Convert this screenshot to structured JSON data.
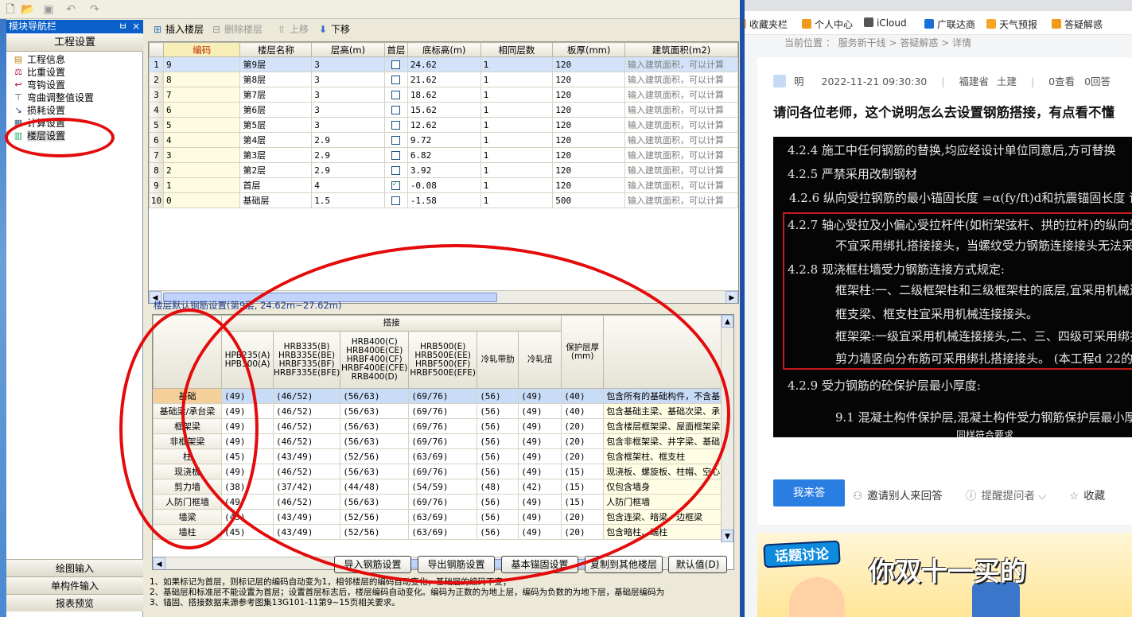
{
  "app": {
    "quick_toolbar": [
      "new-icon",
      "open-icon",
      "save-icon",
      "undo-icon",
      "redo-icon"
    ],
    "nav": {
      "title": "模块导航栏",
      "pin": "ㅂ",
      "close": "×",
      "header": "工程设置",
      "items": [
        {
          "label": "工程信息",
          "icon": "info-icon"
        },
        {
          "label": "比重设置",
          "icon": "weight-icon"
        },
        {
          "label": "弯钩设置",
          "icon": "hook-icon"
        },
        {
          "label": "弯曲调整值设置",
          "icon": "bend-icon"
        },
        {
          "label": "损耗设置",
          "icon": "loss-icon"
        },
        {
          "label": "计算设置",
          "icon": "calc-icon"
        },
        {
          "label": "楼层设置",
          "icon": "floor-icon",
          "selected": true
        }
      ],
      "bottom": [
        "绘图输入",
        "单构件输入",
        "报表预览"
      ]
    },
    "toolbar": {
      "insert": "插入楼层",
      "delete": "删除楼层",
      "up": "上移",
      "down": "下移"
    },
    "floors": {
      "columns": [
        "编码",
        "楼层名称",
        "层高(m)",
        "首层",
        "底标高(m)",
        "相同层数",
        "板厚(mm)",
        "建筑面积(m2)"
      ],
      "rows": [
        {
          "n": "1",
          "code": "9",
          "name": "第9层",
          "height": "3",
          "first": false,
          "base": "24.62",
          "same": "1",
          "slab": "120",
          "area": "输入建筑面积，可以计算"
        },
        {
          "n": "2",
          "code": "8",
          "name": "第8层",
          "height": "3",
          "first": false,
          "base": "21.62",
          "same": "1",
          "slab": "120",
          "area": "输入建筑面积，可以计算"
        },
        {
          "n": "3",
          "code": "7",
          "name": "第7层",
          "height": "3",
          "first": false,
          "base": "18.62",
          "same": "1",
          "slab": "120",
          "area": "输入建筑面积，可以计算"
        },
        {
          "n": "4",
          "code": "6",
          "name": "第6层",
          "height": "3",
          "first": false,
          "base": "15.62",
          "same": "1",
          "slab": "120",
          "area": "输入建筑面积，可以计算"
        },
        {
          "n": "5",
          "code": "5",
          "name": "第5层",
          "height": "3",
          "first": false,
          "base": "12.62",
          "same": "1",
          "slab": "120",
          "area": "输入建筑面积，可以计算"
        },
        {
          "n": "6",
          "code": "4",
          "name": "第4层",
          "height": "2.9",
          "first": false,
          "base": "9.72",
          "same": "1",
          "slab": "120",
          "area": "输入建筑面积，可以计算"
        },
        {
          "n": "7",
          "code": "3",
          "name": "第3层",
          "height": "2.9",
          "first": false,
          "base": "6.82",
          "same": "1",
          "slab": "120",
          "area": "输入建筑面积，可以计算"
        },
        {
          "n": "8",
          "code": "2",
          "name": "第2层",
          "height": "2.9",
          "first": false,
          "base": "3.92",
          "same": "1",
          "slab": "120",
          "area": "输入建筑面积，可以计算"
        },
        {
          "n": "9",
          "code": "1",
          "name": "首层",
          "height": "4",
          "first": true,
          "base": "-0.08",
          "same": "1",
          "slab": "120",
          "area": "输入建筑面积，可以计算"
        },
        {
          "n": "10",
          "code": "0",
          "name": "基础层",
          "height": "1.5",
          "first": false,
          "base": "-1.58",
          "same": "1",
          "slab": "500",
          "area": "输入建筑面积，可以计算"
        }
      ]
    },
    "rebar": {
      "section_title": "楼层默认钢筋设置(第9层, 24.62m~27.62m)",
      "group_header": "搭接",
      "columns": [
        "HPB235(A)\nHPB300(A)",
        "HRB335(B)\nHRB335E(BE)\nHRBF335(BF)\nHRBF335E(BFE)",
        "HRB400(C)\nHRB400E(CE)\nHRBF400(CF)\nHRBF400E(CFE)\nRRB400(D)",
        "HRB500(E)\nHRB500E(EE)\nHRBF500(EF)\nHRBF500E(EFE)",
        "冷轧带肋",
        "冷轧扭",
        "保护层厚\n(mm)",
        ""
      ],
      "rows": [
        {
          "label": "基础",
          "v": [
            "(49)",
            "(46/52)",
            "(56/63)",
            "(69/76)",
            "(56)",
            "(49)",
            "(40)"
          ],
          "desc": "包含所有的基础构件，不含基"
        },
        {
          "label": "基础梁/承台梁",
          "v": [
            "(49)",
            "(46/52)",
            "(56/63)",
            "(69/76)",
            "(56)",
            "(49)",
            "(40)"
          ],
          "desc": "包含基础主梁、基础次梁、承"
        },
        {
          "label": "框架梁",
          "v": [
            "(49)",
            "(46/52)",
            "(56/63)",
            "(69/76)",
            "(56)",
            "(49)",
            "(20)"
          ],
          "desc": "包含楼层框架梁、屋面框架梁"
        },
        {
          "label": "非框架梁",
          "v": [
            "(49)",
            "(46/52)",
            "(56/63)",
            "(69/76)",
            "(56)",
            "(49)",
            "(20)"
          ],
          "desc": "包含非框架梁、井字梁、基础"
        },
        {
          "label": "柱",
          "v": [
            "(45)",
            "(43/49)",
            "(52/56)",
            "(63/69)",
            "(56)",
            "(49)",
            "(20)"
          ],
          "desc": "包含框架柱、框支柱"
        },
        {
          "label": "现浇板",
          "v": [
            "(49)",
            "(46/52)",
            "(56/63)",
            "(69/76)",
            "(56)",
            "(49)",
            "(15)"
          ],
          "desc": "现浇板、螺旋板、柱帽、空心"
        },
        {
          "label": "剪力墙",
          "v": [
            "(38)",
            "(37/42)",
            "(44/48)",
            "(54/59)",
            "(48)",
            "(42)",
            "(15)"
          ],
          "desc": "仅包含墙身"
        },
        {
          "label": "人防门框墙",
          "v": [
            "(49)",
            "(46/52)",
            "(56/63)",
            "(69/76)",
            "(56)",
            "(49)",
            "(15)"
          ],
          "desc": "人防门框墙"
        },
        {
          "label": "墙梁",
          "v": [
            "(45)",
            "(43/49)",
            "(52/56)",
            "(63/69)",
            "(56)",
            "(49)",
            "(20)"
          ],
          "desc": "包含连梁、暗梁、边框梁"
        },
        {
          "label": "墙柱",
          "v": [
            "(45)",
            "(43/49)",
            "(52/56)",
            "(63/69)",
            "(56)",
            "(49)",
            "(20)"
          ],
          "desc": "包含暗柱、端柱"
        }
      ],
      "buttons": [
        "导入钢筋设置",
        "导出钢筋设置",
        "基本锚固设置",
        "复制到其他楼层",
        "默认值(D)"
      ]
    },
    "notes": [
      "1、如果标记为首层，则标记层的编码自动变为1，相邻楼层的编码自动变化，基础层的编码不变；",
      "2、基础层和标准层不能设置为首层；设置首层标志后，楼层编码自动变化。编码为正数的为地上层，编码为负数的为地下层，基础层编码为",
      "3、锚固、搭接数据来源参考图集13G101-11第9~15页相关要求。"
    ]
  },
  "browser": {
    "bookmarks": [
      {
        "label": "收藏夹栏",
        "color": "#f2b632"
      },
      {
        "label": "个人中心",
        "color": "#f09a1a"
      },
      {
        "label": "iCloud",
        "color": "#555555"
      },
      {
        "label": "广联达商",
        "color": "#1a6ed8"
      },
      {
        "label": "天气预报",
        "color": "#f5a623"
      },
      {
        "label": "答疑解惑",
        "color": "#f09a1a"
      }
    ],
    "breadcrumb": "当前位置 ： 服务新干线 > 答疑解惑 > 详情",
    "question": {
      "author": "明",
      "date": "2022-11-21 09:30:30",
      "region": "福建省",
      "category": "土建",
      "views": "0查看",
      "answers": "0回答",
      "title": "请问各位老师，这个说明怎么去设置钢筋搭接，有点看不懂",
      "image_lines": [
        "4.2.4  施工中任何钢筋的替换,均应经设计单位同意后,方可替换",
        "4.2.5  严禁采用改制钢材",
        "4.2.6  纵向受拉钢筋的最小锚固长度 =α(fy/ft)d和抗震锚固长度 详见《16G101-1第",
        "4.2.7  轴心受拉及小偏心受拉杆件(如桁架弦杆、拱的拉杆)的纵向受力钢筋不得采用绑扎搭接接头",
        "不宜采用绑扎搭接接头，当螺纹受力钢筋连接接头无法采用机械连接时可采用焊接",
        "4.2.8  现浇框柱墙受力钢筋连接方式规定:",
        "框架柱:一、二级框架柱和三级框架柱的底层,宜采用机械连接接头,也可采用绑扎",
        "框支梁、框支柱宜采用机械连接接头。",
        "框架梁:一级宜采用机械连接接头,二、三、四级可采用绑扎搭接接头。",
        "剪力墙竖向分布筋可采用绑扎搭接接头。              (本工程d 22的钢筋",
        "4.2.9  受力钢筋的砼保护层最小厚度:",
        "9.1  混凝土构件保护层,混凝土构件受力钢筋保护层最小厚度按相应环境类别(详",
        "同样符合要求"
      ]
    },
    "actions": {
      "answer": "我来答",
      "invite": "邀请别人来回答",
      "remind": "提醒提问者",
      "favorite": "收藏"
    },
    "banner": {
      "tag": "话题讨论",
      "title": "你双十一买的"
    }
  }
}
